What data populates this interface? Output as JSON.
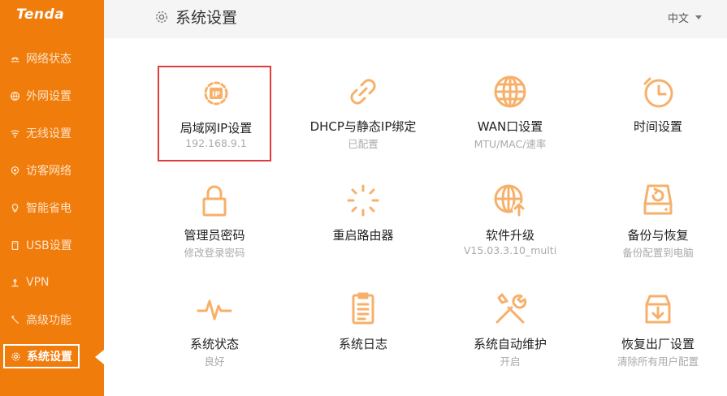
{
  "app": {
    "logo": "Tenda",
    "header_title": "系统设置",
    "language": "中文"
  },
  "sidebar": {
    "items": [
      {
        "label": "网络状态",
        "icon": "network-status-icon"
      },
      {
        "label": "外网设置",
        "icon": "globe-icon"
      },
      {
        "label": "无线设置",
        "icon": "wifi-icon"
      },
      {
        "label": "访客网络",
        "icon": "guest-icon"
      },
      {
        "label": "智能省电",
        "icon": "bulb-icon"
      },
      {
        "label": "USB设置",
        "icon": "usb-icon"
      },
      {
        "label": "VPN",
        "icon": "vpn-icon"
      },
      {
        "label": "高级功能",
        "icon": "wrench-icon"
      },
      {
        "label": "系统设置",
        "icon": "gear-icon",
        "active": true
      }
    ]
  },
  "tiles": [
    {
      "title": "局域网IP设置",
      "sub": "192.168.9.1",
      "icon": "lan-gear-icon",
      "selected": true
    },
    {
      "title": "DHCP与静态IP绑定",
      "sub": "已配置",
      "icon": "link-icon"
    },
    {
      "title": "WAN口设置",
      "sub": "MTU/MAC/速率",
      "icon": "globe-icon"
    },
    {
      "title": "时间设置",
      "sub": "",
      "icon": "clock-icon"
    },
    {
      "title": "管理员密码",
      "sub": "修改登录密码",
      "icon": "lock-icon"
    },
    {
      "title": "重启路由器",
      "sub": "",
      "icon": "spinner-icon"
    },
    {
      "title": "软件升级",
      "sub": "V15.03.3.10_multi",
      "icon": "globe-upload-icon"
    },
    {
      "title": "备份与恢复",
      "sub": "备份配置到电脑",
      "icon": "backup-icon"
    },
    {
      "title": "系统状态",
      "sub": "良好",
      "icon": "pulse-icon"
    },
    {
      "title": "系统日志",
      "sub": "",
      "icon": "log-icon"
    },
    {
      "title": "系统自动维护",
      "sub": "开启",
      "icon": "tools-icon"
    },
    {
      "title": "恢复出厂设置",
      "sub": "清除所有用户配置",
      "icon": "restore-box-icon"
    }
  ],
  "colors": {
    "sidebar": "#f07c0b",
    "icon": "#f7b06a",
    "selected_border": "#e03c3c",
    "header_bg": "#f5f5f5"
  }
}
